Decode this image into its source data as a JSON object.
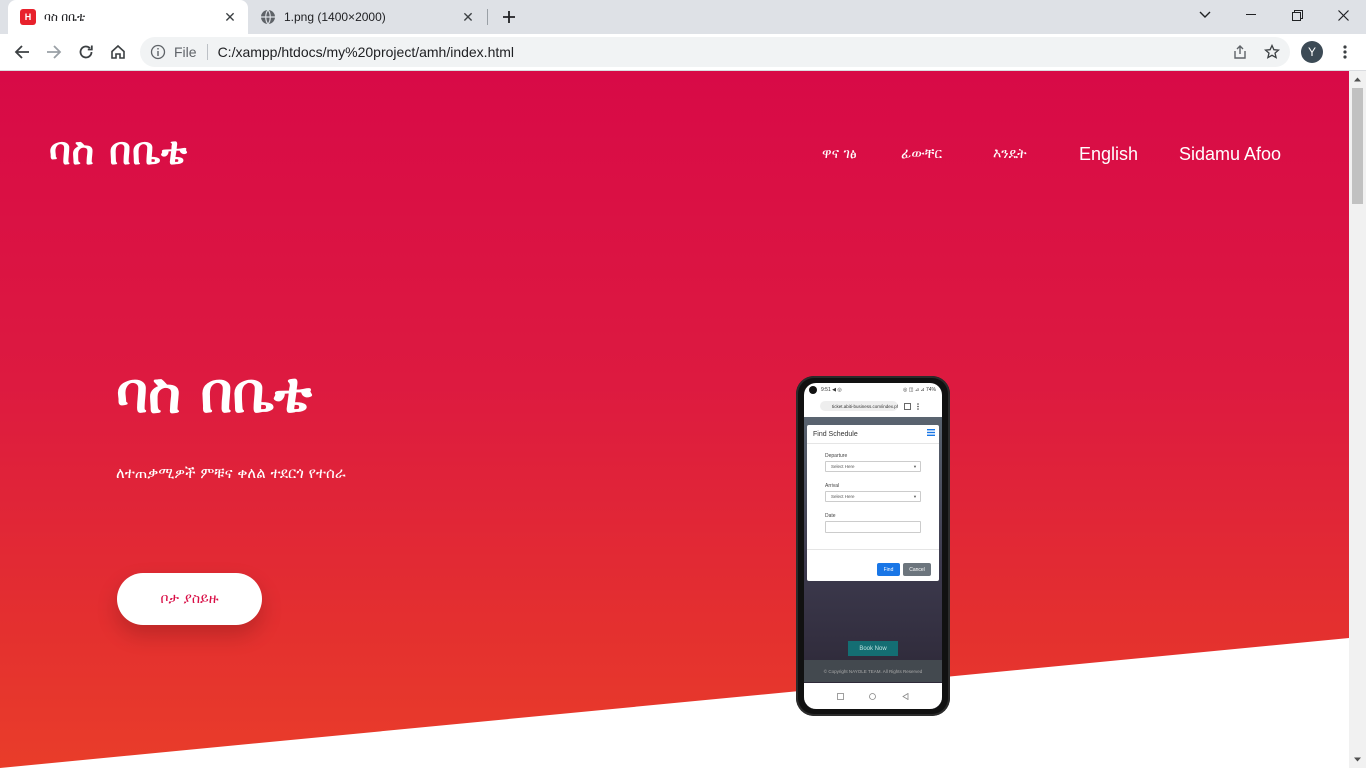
{
  "browser": {
    "tabs": [
      {
        "title": "ባስ በቤቴ",
        "favicon_letter": "H",
        "active": true
      },
      {
        "title": "1.png (1400×2000)",
        "active": false
      }
    ],
    "address": {
      "scheme_label": "File",
      "url": "C:/xampp/htdocs/my%20project/amh/index.html"
    },
    "profile_initial": "Y"
  },
  "site": {
    "brand": "ባስ በቤቴ",
    "nav": [
      "ዋና ገፅ",
      "ፊውቸር",
      "እንዴት",
      "English",
      "Sidamu Afoo"
    ],
    "hero": {
      "title": "ባስ በቤቴ",
      "subtitle": "ለተጠቃሚዎች ምቹና ቀለል ተደርጎ የተሰራ",
      "cta_label": "ቦታ ያስይዙ"
    },
    "colors": {
      "hero_top": "#d80a47",
      "hero_bottom": "#e93d2a",
      "cta_text": "#d90e46"
    }
  },
  "phone": {
    "status_left": "9:51 ◀ ◎",
    "status_right": "◎ ◫ ⊿ ⊿ 74%",
    "url": "ticket.abiti-business.com/index.ph",
    "modal_title": "Find Schedule",
    "departure_label": "Departure",
    "departure_value": "Select Here",
    "arrival_label": "Arrival",
    "arrival_value": "Select Here",
    "date_label": "Date",
    "find_label": "Find",
    "cancel_label": "Cancel",
    "book_now": "Book Now",
    "footer": "© Copyright NAYOLE TEAM. All Rights Reserved"
  }
}
